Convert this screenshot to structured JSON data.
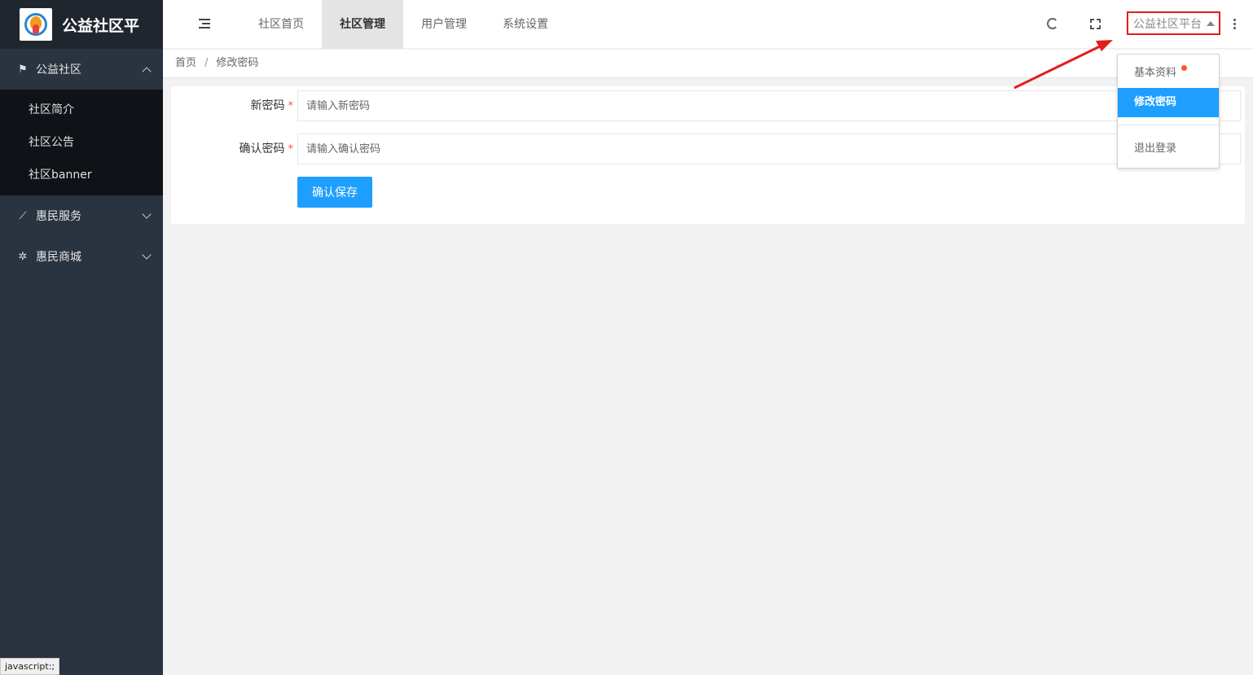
{
  "sidebar": {
    "logo_title": "公益社区平",
    "groups": [
      {
        "label": "公益社区",
        "icon": "flag-icon",
        "items": [
          "社区简介",
          "社区公告",
          "社区banner"
        ]
      },
      {
        "label": "惠民服务",
        "icon": "telescope-icon"
      },
      {
        "label": "惠民商城",
        "icon": "pinwheel-icon"
      }
    ]
  },
  "header": {
    "tabs": [
      "社区首页",
      "社区管理",
      "用户管理",
      "系统设置"
    ],
    "active_tab": "社区管理",
    "user_menu_label": "公益社区平台"
  },
  "breadcrumb": {
    "home": "首页",
    "sep": "/",
    "current": "修改密码"
  },
  "form": {
    "new_password_label": "新密码",
    "new_password_placeholder": "请输入新密码",
    "confirm_password_label": "确认密码",
    "confirm_password_placeholder": "请输入确认密码",
    "required_mark": "*",
    "save_label": "确认保存"
  },
  "dropdown": {
    "items": [
      "基本资料",
      "修改密码",
      "退出登录"
    ],
    "active_item": "修改密码"
  },
  "status_bar": "javascript:;",
  "colors": {
    "sidebar_bg": "#2a3340",
    "primary": "#1e9fff",
    "highlight_box": "#e31d1d",
    "badge_dot": "#ff5722"
  }
}
